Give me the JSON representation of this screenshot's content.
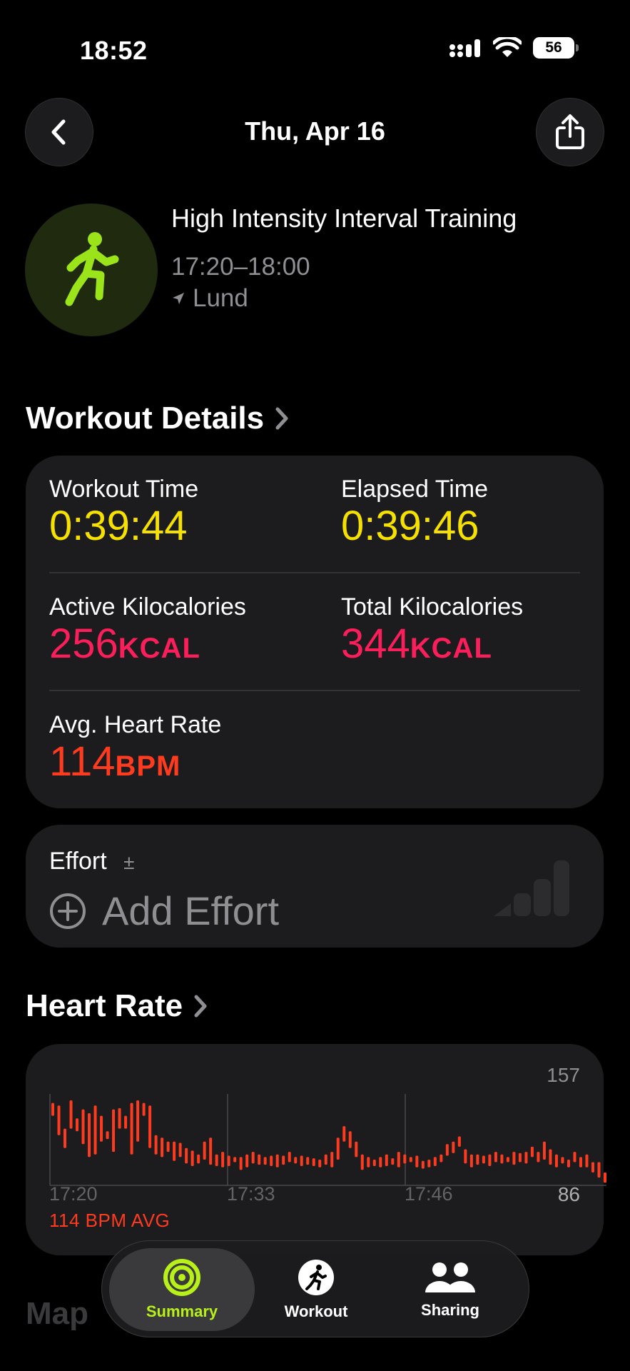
{
  "status": {
    "time": "18:52",
    "battery": "56"
  },
  "header": {
    "date": "Thu, Apr 16"
  },
  "workout": {
    "name": "High Intensity Interval Training",
    "time_range": "17:20–18:00",
    "location": "Lund",
    "accent_color": "#a6e22a"
  },
  "details": {
    "title": "Workout Details",
    "workout_time_label": "Workout Time",
    "workout_time": "0:39:44",
    "elapsed_time_label": "Elapsed Time",
    "elapsed_time": "0:39:46",
    "active_kcal_label": "Active Kilocalories",
    "active_kcal": "256",
    "total_kcal_label": "Total Kilocalories",
    "total_kcal": "344",
    "kcal_unit": "KCAL",
    "avg_hr_label": "Avg. Heart Rate",
    "avg_hr": "114",
    "bpm_unit": "BPM"
  },
  "effort": {
    "label": "Effort",
    "plusminus": "±",
    "add_label": "Add Effort"
  },
  "heart_rate": {
    "title": "Heart Rate",
    "max": "157",
    "min": "86",
    "ticks": [
      "17:20",
      "17:33",
      "17:46"
    ],
    "avg_label": "114 BPM AVG"
  },
  "chart_data": {
    "type": "bar",
    "ylim": [
      86,
      157
    ],
    "x_ticks": [
      "17:20",
      "17:33",
      "17:46"
    ],
    "series": [
      {
        "ranges": [
          [
            140,
            150
          ],
          [
            125,
            148
          ],
          [
            115,
            130
          ],
          [
            130,
            152
          ],
          [
            128,
            138
          ],
          [
            118,
            145
          ],
          [
            108,
            142
          ],
          [
            110,
            148
          ],
          [
            120,
            140
          ],
          [
            122,
            128
          ],
          [
            112,
            145
          ],
          [
            130,
            146
          ],
          [
            130,
            140
          ],
          [
            110,
            150
          ],
          [
            120,
            152
          ],
          [
            140,
            150
          ],
          [
            115,
            148
          ],
          [
            110,
            125
          ],
          [
            108,
            123
          ],
          [
            112,
            120
          ],
          [
            105,
            120
          ],
          [
            108,
            119
          ],
          [
            103,
            115
          ],
          [
            101,
            113
          ],
          [
            103,
            110
          ],
          [
            106,
            120
          ],
          [
            102,
            123
          ],
          [
            101,
            110
          ],
          [
            100,
            112
          ],
          [
            101,
            109
          ],
          [
            104,
            108
          ],
          [
            98,
            108
          ],
          [
            100,
            110
          ],
          [
            103,
            112
          ],
          [
            102,
            110
          ],
          [
            102,
            108
          ],
          [
            101,
            109
          ],
          [
            100,
            110
          ],
          [
            102,
            109
          ],
          [
            104,
            112
          ],
          [
            103,
            108
          ],
          [
            101,
            109
          ],
          [
            102,
            108
          ],
          [
            101,
            107
          ],
          [
            100,
            106
          ],
          [
            102,
            110
          ],
          [
            100,
            112
          ],
          [
            106,
            123
          ],
          [
            120,
            132
          ],
          [
            115,
            128
          ],
          [
            108,
            120
          ],
          [
            98,
            110
          ],
          [
            100,
            108
          ],
          [
            101,
            106
          ],
          [
            100,
            108
          ],
          [
            101,
            110
          ],
          [
            102,
            107
          ],
          [
            100,
            112
          ],
          [
            103,
            110
          ],
          [
            104,
            108
          ],
          [
            100,
            109
          ],
          [
            99,
            105
          ],
          [
            100,
            106
          ],
          [
            101,
            108
          ],
          [
            104,
            110
          ],
          [
            109,
            118
          ],
          [
            111,
            120
          ],
          [
            116,
            124
          ],
          [
            103,
            114
          ],
          [
            100,
            110
          ],
          [
            102,
            110
          ],
          [
            103,
            109
          ],
          [
            101,
            110
          ],
          [
            104,
            112
          ],
          [
            103,
            110
          ],
          [
            104,
            108
          ],
          [
            102,
            112
          ],
          [
            104,
            111
          ],
          [
            103,
            112
          ],
          [
            108,
            116
          ],
          [
            104,
            112
          ],
          [
            106,
            120
          ],
          [
            102,
            114
          ],
          [
            100,
            110
          ],
          [
            103,
            108
          ],
          [
            100,
            106
          ],
          [
            104,
            112
          ],
          [
            100,
            108
          ],
          [
            100,
            110
          ],
          [
            96,
            104
          ],
          [
            92,
            104
          ],
          [
            88,
            96
          ]
        ]
      }
    ]
  },
  "tabs": [
    {
      "label": "Summary"
    },
    {
      "label": "Workout"
    },
    {
      "label": "Sharing"
    }
  ],
  "map": {
    "title": "Map"
  }
}
